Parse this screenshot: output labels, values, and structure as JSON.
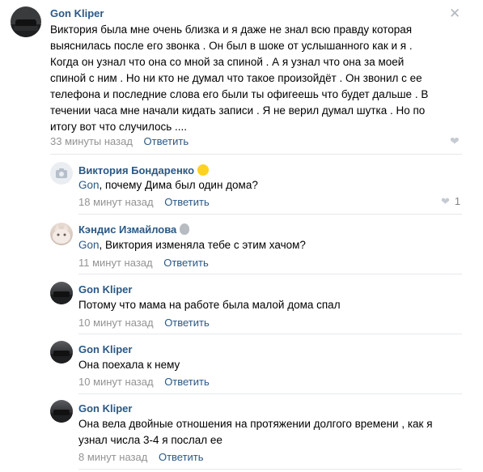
{
  "post": {
    "author": "Gon Kliper",
    "text_lines": [
      "Виктория была мне очень близка и я даже не знал всю правду которая",
      "выяснилась после его звонка . Он был в шоке от услышанного как и я .",
      "Когда он узнал что она со мной за спиной . А я узнал что она за моей",
      "спиной с ним . Но ни кто не думал что такое произойдёт . Он звонил с ее",
      "телефона и последние слова его были ты офигеешь что будет дальше . В",
      "течении часа мне начали кидать записи . Я не верил думал шутка . Но по",
      "итогу вот что случилось ...."
    ],
    "time": "33 минуты назад",
    "reply_label": "Ответить",
    "close_icon": "✕"
  },
  "comments": [
    {
      "author": "Виктория Бондаренко",
      "mention": "Gon",
      "text": ", почему Дима был один дома?",
      "time": "18 минут назад",
      "reply_label": "Ответить",
      "likes": "1",
      "avatar": "camera-icon",
      "emoji": "smile"
    },
    {
      "author": "Кэндис Измайлова",
      "mention": "Gon",
      "text": ", Виктория изменяла тебе с этим хачом?",
      "time": "11 минут назад",
      "reply_label": "Ответить",
      "avatar": "cat",
      "emoji": "alien"
    },
    {
      "author": "Gon Kliper",
      "mention": "",
      "text": "Потому что мама на работе была малой дома спал",
      "time": "10 минут назад",
      "reply_label": "Ответить",
      "avatar": "car"
    },
    {
      "author": "Gon Kliper",
      "mention": "",
      "text": "Она поехала к нему",
      "time": "10 минут назад",
      "reply_label": "Ответить",
      "avatar": "car"
    },
    {
      "author": "Gon Kliper",
      "mention": "",
      "text_lines": [
        "Она вела двойные отношения на протяжении долгого времени , как я",
        "узнал числа 3-4 я послал ее"
      ],
      "time": "8 минут назад",
      "reply_label": "Ответить",
      "avatar": "car"
    }
  ],
  "colors": {
    "link": "#2a5885",
    "meta": "#939393",
    "divider": "#e7e8ec"
  }
}
